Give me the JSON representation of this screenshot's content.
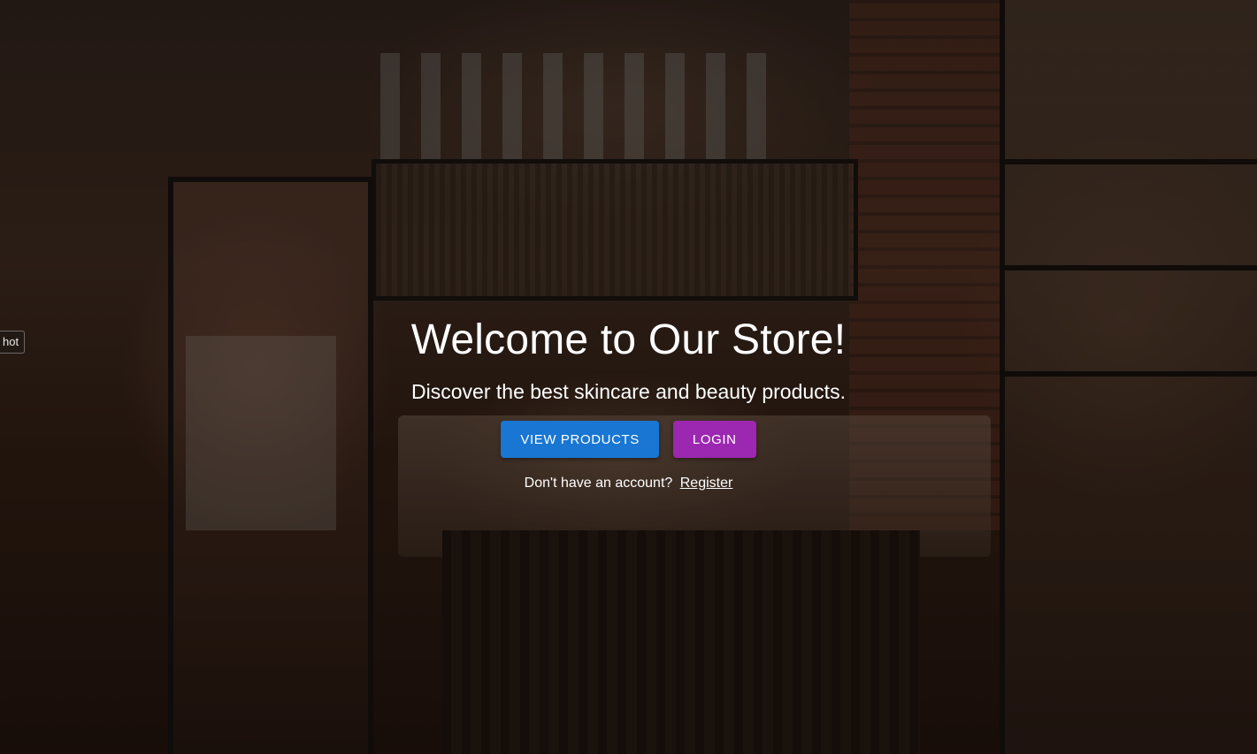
{
  "edge_tab": {
    "label": "hot"
  },
  "hero": {
    "title": "Welcome to Our Store!",
    "subtitle": "Discover the best skincare and beauty products."
  },
  "actions": {
    "view_products_label": "VIEW PRODUCTS",
    "login_label": "LOGIN"
  },
  "register": {
    "prompt": "Don't have an account?",
    "link_label": "Register"
  },
  "colors": {
    "primary": "#1976d2",
    "secondary": "#9c27b0",
    "overlay": "rgba(0,0,0,0.42)"
  },
  "background": {
    "image": "store-interior-photo"
  }
}
